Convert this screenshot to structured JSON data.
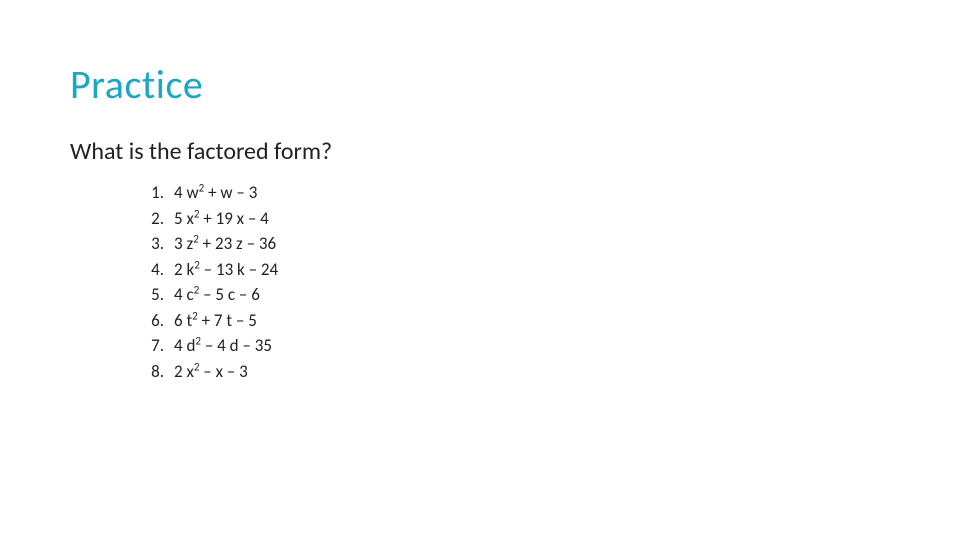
{
  "slide": {
    "title": "Practice",
    "question": "What is the factored form?",
    "items": [
      {
        "num": "1.",
        "coef": "4 w",
        "exp": "2",
        "rest": " + w – 3"
      },
      {
        "num": "2.",
        "coef": "5 x",
        "exp": "2",
        "rest": " + 19 x – 4"
      },
      {
        "num": "3.",
        "coef": "3 z",
        "exp": "2",
        "rest": " + 23 z – 36"
      },
      {
        "num": "4.",
        "coef": "2 k",
        "exp": "2",
        "rest": " – 13 k – 24"
      },
      {
        "num": "5.",
        "coef": "4 c",
        "exp": "2",
        "rest": " – 5 c – 6"
      },
      {
        "num": "6.",
        "coef": "6 t",
        "exp": "2",
        "rest": " + 7 t – 5"
      },
      {
        "num": "7.",
        "coef": "4 d",
        "exp": "2",
        "rest": " – 4 d – 35"
      },
      {
        "num": "8.",
        "coef": "2 x",
        "exp": "2",
        "rest": " – x – 3"
      }
    ]
  }
}
